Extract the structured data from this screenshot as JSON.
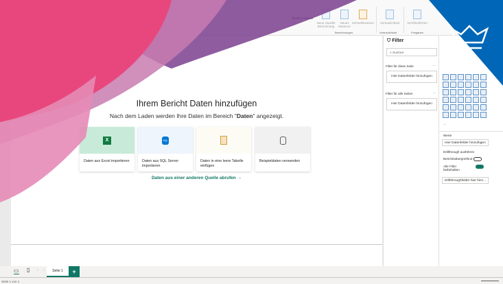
{
  "ribbon": {
    "buttons": [
      {
        "label": "Neue visuelle Berechnung"
      },
      {
        "label": "Neues Measure"
      },
      {
        "label": "Schnellmeasure"
      },
      {
        "label": "Vertraulichkeit"
      },
      {
        "label": "Veröffentlichen"
      }
    ],
    "partial_label": "Weitere Visuals",
    "groups": [
      "Berechnungen",
      "Vertraulichkeit",
      "Freigaben"
    ]
  },
  "canvas": {
    "title": "Ihrem Bericht Daten hinzufügen",
    "subtitle_pre": "Nach dem Laden werden Ihre Daten im Bereich \"",
    "subtitle_bold": "Daten",
    "subtitle_post": "\" angezeigt.",
    "cards": [
      {
        "label": "Daten aus Excel importieren",
        "icon": "excel-icon",
        "bg": "#c8ebd9"
      },
      {
        "label": "Daten aus SQL Server importieren",
        "icon": "sql-server-icon",
        "bg": "#eef5fc"
      },
      {
        "label": "Daten in eine leere Tabelle einfügen",
        "icon": "paste-icon",
        "bg": "#fdfcf4"
      },
      {
        "label": "Beispieldaten verwenden",
        "icon": "sample-data-icon",
        "bg": "#f1f1f1"
      }
    ],
    "other_source_link": "Daten aus einer anderen Quelle abrufen →"
  },
  "filter": {
    "title": "Filter",
    "search_placeholder": "Suchen",
    "page_section": "Filter für diese Seite",
    "all_section": "Filter für alle Seiten",
    "drop_label": "Hier Datenfelder hinzufügen",
    "more": "..."
  },
  "viz": {
    "more": "...",
    "values_label": "Werte",
    "values_drop": "Hier Datenfelder hinzufügen",
    "drillthrough_title": "Drillthrough ausführen",
    "cross_report": "Berichtsübergreifend",
    "cross_report_on": false,
    "keep_filters": "Alle Filter beibehalten",
    "keep_filters_on": true,
    "drill_drop": "Drillthroughfelder hier hinz..."
  },
  "tabs": {
    "pages": [
      "Seite 1"
    ],
    "add": "+"
  },
  "status": {
    "page": "Seite 1 von 1"
  },
  "colors": {
    "accent": "#117865",
    "brand_blue": "#0067b8",
    "pink": "#e8477d",
    "purple": "#7b3f8f"
  }
}
